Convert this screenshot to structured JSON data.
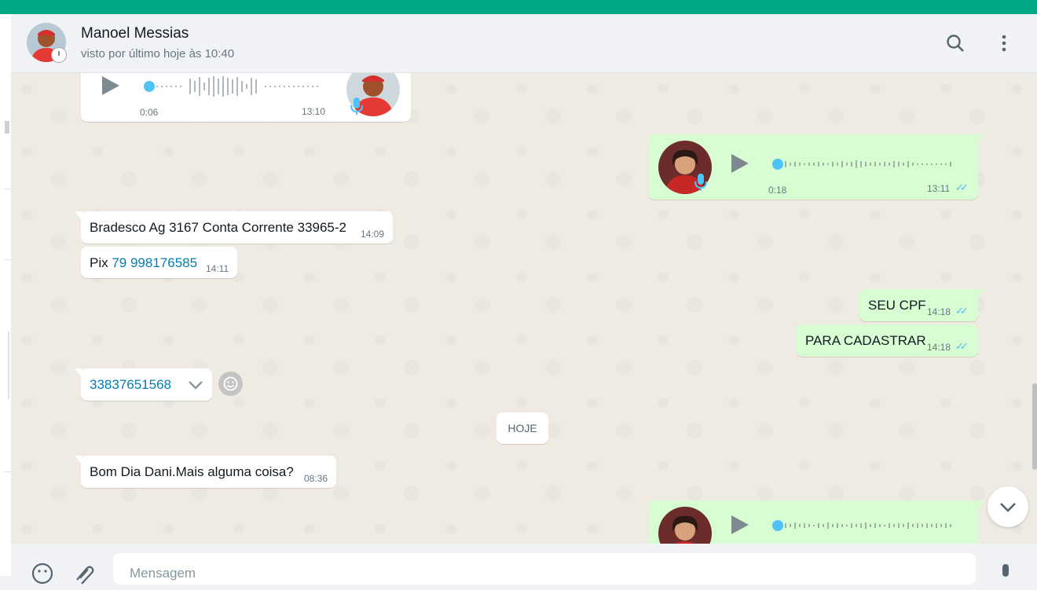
{
  "colors": {
    "accent": "#00a884",
    "incoming_bubble": "#ffffff",
    "outgoing_bubble": "#d9fdd3",
    "link": "#027eb5",
    "read_ticks": "#53bdeb",
    "chat_bg": "#efeae2"
  },
  "header": {
    "contact_name": "Manoel Messias",
    "last_seen": "visto por último hoje às 10:40",
    "icons": [
      "search-icon",
      "menu-dots-icon"
    ]
  },
  "messages": {
    "voice_in_1": {
      "duration": "0:06",
      "time": "13:10",
      "progress": 0.0
    },
    "voice_out_1": {
      "duration": "0:18",
      "time": "13:11",
      "progress": 0.0
    },
    "text_bank": {
      "text": "Bradesco Ag 3167 Conta Corrente 33965-2",
      "time": "14:09"
    },
    "text_pix": {
      "prefix": "Pix ",
      "link": "79 998176585",
      "time": "14:11"
    },
    "text_cpf": {
      "text": "SEU CPF",
      "time": "14:18"
    },
    "text_cadastrar": {
      "text": "PARA CADASTRAR",
      "time": "14:18"
    },
    "text_number": {
      "link": "33837651568"
    },
    "date_chip": "HOJE",
    "text_bomdia": {
      "text": "Bom Dia Dani.Mais alguma coisa?",
      "time": "08:36"
    }
  },
  "footer": {
    "placeholder": "Mensagem",
    "icons": [
      "emoji-icon",
      "attach-icon",
      "mic-icon"
    ]
  }
}
